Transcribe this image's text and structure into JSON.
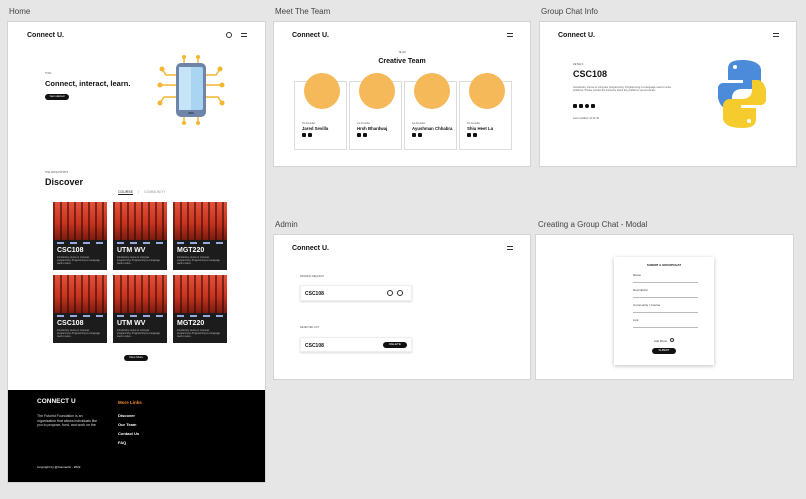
{
  "labels": {
    "home": "Home",
    "team": "Meet The Team",
    "group": "Group Chat Info",
    "admin": "Admin",
    "modal": "Creating a Group Chat - Modal"
  },
  "brand": "Connect U.",
  "home": {
    "hero_eyebrow": "TOOL",
    "hero_title": "Connect, interact, learn.",
    "hero_button": "Get started",
    "discover_eyebrow": "THE GROUPCHATS",
    "discover_title": "Discover",
    "tabs": [
      "COURSE",
      "COMMUNITY"
    ],
    "cards": [
      {
        "title": "CSC108",
        "desc": "Introductory course to computer programming. Programming is a language used to solve..."
      },
      {
        "title": "UTM WV",
        "desc": "Introductory course to computer programming. Programming is a language used to solve..."
      },
      {
        "title": "MGT220",
        "desc": "Introductory course to computer programming. Programming is a language used to solve..."
      },
      {
        "title": "CSC108",
        "desc": "Introductory course to computer programming. Programming is a language used to solve..."
      },
      {
        "title": "UTM WV",
        "desc": "Introductory course to computer programming. Programming is a language used to solve..."
      },
      {
        "title": "MGT220",
        "desc": "Introductory course to computer programming. Programming is a language used to solve..."
      }
    ],
    "view_more": "View More",
    "footer": {
      "title": "CONNECT U",
      "desc": "The Futurist Foundation is an organisation that allows individuals like you to propose, fund, and work on the",
      "links_title": "More Links",
      "links": [
        "Discover",
        "Our Team",
        "Contact Us",
        "FAQ"
      ],
      "copyright": "Copyright by @ConnectU - 2022"
    }
  },
  "team": {
    "eyebrow": "TE 2M",
    "title": "Creative Team",
    "members": [
      {
        "role": "Co-Founder",
        "name": "Jared Sevilla"
      },
      {
        "role": "Co-Founder",
        "name": "Hrsh Bhardwaj"
      },
      {
        "role": "Co-Founder",
        "name": "Ayushman Chhabra"
      },
      {
        "role": "Co-Founder",
        "name": "Shiu Heet Lu"
      }
    ]
  },
  "group": {
    "eyebrow": "DETAILS",
    "title": "CSC108",
    "desc": "Introductory course to computer programming. Programming is a language used to solve problems. Please contact the instructor about any problems you encounter.",
    "updated": "Last modified: 12:31:45"
  },
  "admin": {
    "requests_label": "PENDING REQUEST",
    "request_course": "CSC108",
    "rejected_label": "REJECTED LIST",
    "rejected_course": "CSC108",
    "reject_button": "DELETE"
  },
  "modal": {
    "title": "SUBMIT A GROUPCHAT",
    "fields": [
      "Name",
      "Description",
      "Community / Course",
      "Link"
    ],
    "upload_label": "Add Photo",
    "submit": "SUBMIT"
  }
}
